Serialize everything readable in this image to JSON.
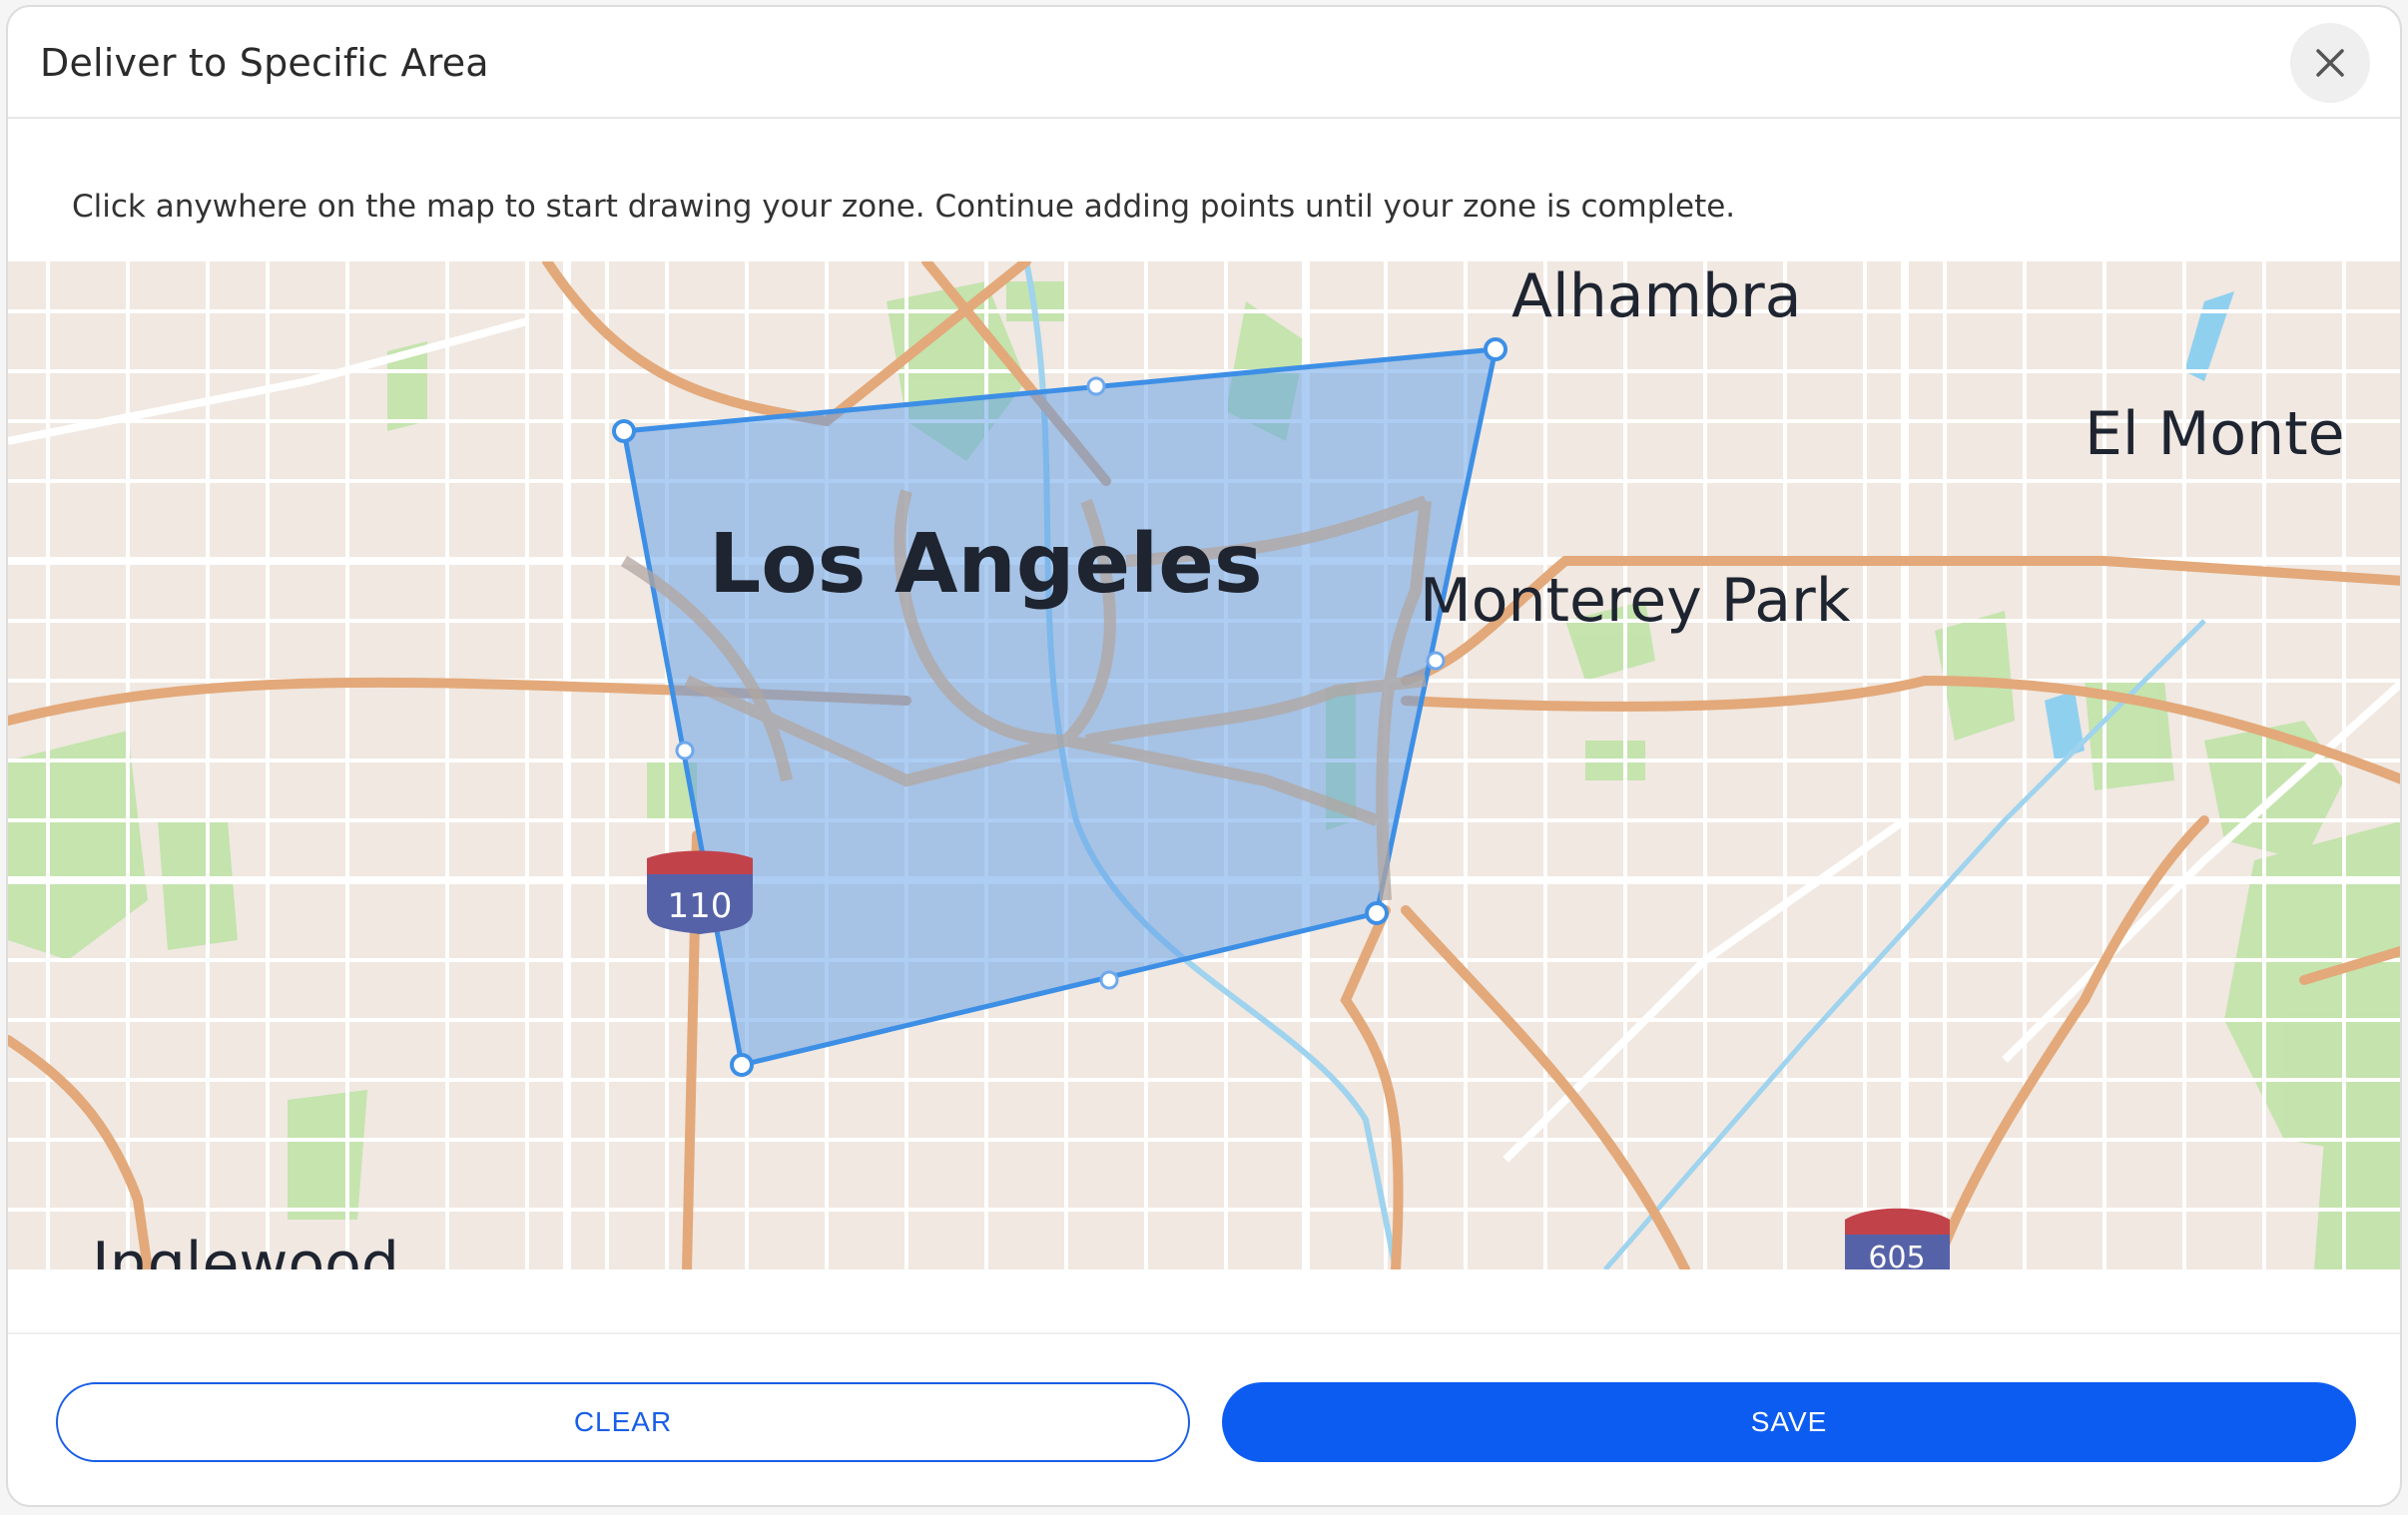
{
  "dialog": {
    "title": "Deliver to Specific Area",
    "instructions": "Click anywhere on the map to start drawing your zone. Continue adding points until your zone is complete."
  },
  "map": {
    "labels": {
      "los_angeles": "Los Angeles",
      "alhambra": "Alhambra",
      "el_monte": "El Monte",
      "monterey_park": "Monterey Park",
      "inglewood": "Inglewood"
    },
    "shields": {
      "i110": "110",
      "i605": "605"
    },
    "zone_fill_color": "#5b9be8",
    "zone_stroke_color": "#3d8fe6"
  },
  "buttons": {
    "clear": "CLEAR",
    "save": "SAVE"
  },
  "colors": {
    "primary": "#0d5cf2",
    "map_background": "#f0e8e1",
    "highway": "#e3a97a",
    "park": "#bde3a4"
  }
}
